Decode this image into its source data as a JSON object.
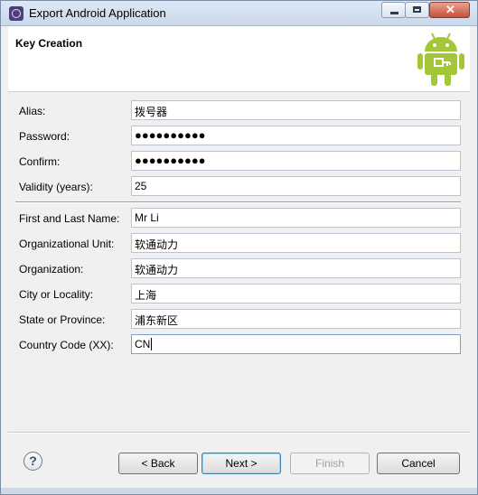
{
  "window": {
    "title": "Export Android Application"
  },
  "header": {
    "heading": "Key Creation"
  },
  "form": {
    "fields": [
      {
        "label": "Alias:",
        "value": "拨号器"
      },
      {
        "label": "Password:",
        "value": "●●●●●●●●●●"
      },
      {
        "label": "Confirm:",
        "value": "●●●●●●●●●●"
      },
      {
        "label": "Validity (years):",
        "value": "25"
      },
      {
        "label": "First and Last Name:",
        "value": "Mr Li"
      },
      {
        "label": "Organizational Unit:",
        "value": "软通动力"
      },
      {
        "label": "Organization:",
        "value": "软通动力"
      },
      {
        "label": "City or Locality:",
        "value": "上海"
      },
      {
        "label": "State or Province:",
        "value": "浦东新区"
      },
      {
        "label": "Country Code (XX):",
        "value": "CN"
      }
    ]
  },
  "buttons": {
    "help": "?",
    "back": "< Back",
    "next": "Next >",
    "finish": "Finish",
    "cancel": "Cancel"
  },
  "icons": {
    "app": "eclipse-icon",
    "logo": "android-robot-icon",
    "minimize": "minimize-icon",
    "maximize": "maximize-icon",
    "close": "close-icon"
  },
  "colors": {
    "android_green": "#a4c639"
  }
}
